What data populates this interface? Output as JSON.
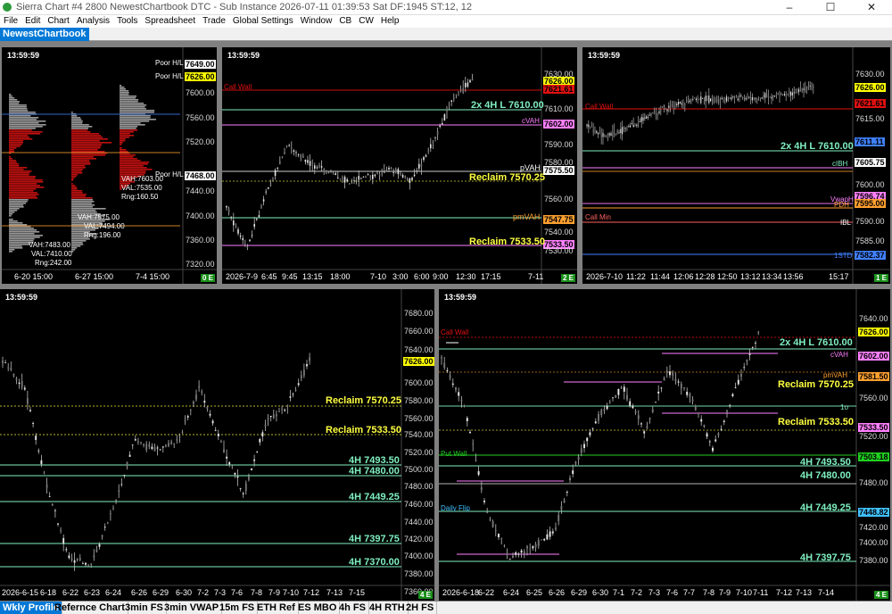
{
  "window": {
    "title": "Sierra Chart #4 2800 NewestChartbook DTC - Sub Instance 2026-07-11  01:39:53 Sat DF:1945  ST:12, 12",
    "minimize": "–",
    "maximize": "☐",
    "close": "✕"
  },
  "menu": [
    "File",
    "Edit",
    "Chart",
    "Analysis",
    "Tools",
    "Spreadsheet",
    "Trade",
    "Global Settings",
    "Window",
    "CB",
    "CW",
    "Help"
  ],
  "chartbook_name": "NewestChartbook",
  "colors": {
    "call_wall": "#e01010",
    "four_h_line": "#7ff0c0",
    "cvah": "#ff80ff",
    "pvah": "#ffffff",
    "reclaim": "#ffff40",
    "pmvah": "#ffa030",
    "put_wall": "#20d020",
    "daily_flip": "#40c0ff",
    "price_tag": "#ffff00"
  },
  "charts": [
    {
      "id": "c1",
      "time": "13:59:59",
      "corner": "0 E",
      "y_labels": [
        "7649.00",
        "7626.00",
        "7600.00",
        "7560.00",
        "7520.00",
        "7468.00",
        "7440.00",
        "7400.00",
        "7360.00",
        "7320.00"
      ],
      "x_labels": [
        "6-20  15:00",
        "6-27  15:00",
        "7-4  15:00"
      ],
      "annotations": [
        {
          "text": "Poor H/L",
          "color": "#ffffff"
        },
        {
          "text": "Poor H/L",
          "color": "#ffffff"
        },
        {
          "text": "Poor H/L",
          "color": "#ffffff"
        },
        {
          "text": "VAH:7603.00",
          "color": "#ffffff"
        },
        {
          "text": "VAL:7535.00",
          "color": "#ffffff"
        },
        {
          "text": "Rng:160.50",
          "color": "#ffffff"
        },
        {
          "text": "VAH:7575.00",
          "color": "#ffffff"
        },
        {
          "text": "VAL:7494.00",
          "color": "#ffffff"
        },
        {
          "text": "Rng:196.00",
          "color": "#ffffff"
        },
        {
          "text": "VAH:7483.00",
          "color": "#ffffff"
        },
        {
          "text": "VAL:7410.00",
          "color": "#ffffff"
        },
        {
          "text": "Rng:242.00",
          "color": "#ffffff"
        }
      ]
    },
    {
      "id": "c2",
      "time": "13:59:59",
      "corner": "2 E",
      "y_labels": [
        "7630.00",
        "7626.00",
        "7621.61",
        "7610.00",
        "7602.00",
        "7590.00",
        "7580.00",
        "7575.50",
        "7560.00",
        "7547.75",
        "7540.00",
        "7533.50",
        "7530.00"
      ],
      "x_labels": [
        "2026-7-9",
        "6:45",
        "9:45",
        "13:15",
        "18:00",
        "7-10",
        "3:00",
        "6:00",
        "9:00",
        "12:30",
        "17:15",
        "7-11"
      ],
      "annotations": [
        {
          "text": "Call Wall",
          "color": "#e01010"
        },
        {
          "text": "2x 4H L  7610.00",
          "color": "#7ff0c0"
        },
        {
          "text": "cVAH",
          "color": "#ff80ff"
        },
        {
          "text": "pVAH",
          "color": "#ffffff"
        },
        {
          "text": "Reclaim  7570.25",
          "color": "#ffff40"
        },
        {
          "text": "pmVAH",
          "color": "#ffa030"
        },
        {
          "text": "Reclaim  7533.50",
          "color": "#ffff40"
        }
      ]
    },
    {
      "id": "c3",
      "time": "13:59:59",
      "corner": "1 E",
      "y_labels": [
        "7630.00",
        "7626.00",
        "7621.61",
        "7615.00",
        "7611.11",
        "7605.75",
        "7600.00",
        "7596.74",
        "7595.00",
        "7590.00",
        "7585.00",
        "7582.37"
      ],
      "x_labels": [
        "2026-7-10",
        "11:22",
        "11:44",
        "12:06",
        "12:28",
        "12:50",
        "13:12",
        "13:34",
        "13:56",
        "15:17"
      ],
      "annotations": [
        {
          "text": "Call Wall",
          "color": "#e01010"
        },
        {
          "text": "2x 4H L  7610.00",
          "color": "#7ff0c0"
        },
        {
          "text": "cIBH",
          "color": "#7ff0c0"
        },
        {
          "text": "VwapH",
          "color": "#ff80ff"
        },
        {
          "text": "PDH",
          "color": "#ffa030"
        },
        {
          "text": "Call Min",
          "color": "#ff6060"
        },
        {
          "text": "IBL",
          "color": "#ffffff"
        },
        {
          "text": "1STD",
          "color": "#4080ff"
        }
      ]
    },
    {
      "id": "c4",
      "time": "13:59:59",
      "corner": "4 E",
      "y_labels": [
        "7680.00",
        "7660.00",
        "7640.00",
        "7626.00",
        "7600.00",
        "7580.00",
        "7560.00",
        "7540.00",
        "7520.00",
        "7500.00",
        "7480.00",
        "7460.00",
        "7440.00",
        "7420.00",
        "7400.00",
        "7380.00",
        "7360.00"
      ],
      "x_labels": [
        "2026-6-15",
        "6-18",
        "6-22",
        "6-23",
        "6-24",
        "6-26",
        "6-29",
        "6-30",
        "7-2",
        "7-3",
        "7-6",
        "7-8",
        "7-9",
        "7-10",
        "7-12",
        "7-13",
        "7-15"
      ],
      "annotations": [
        {
          "text": "Reclaim  7570.25",
          "color": "#ffff40"
        },
        {
          "text": "Reclaim  7533.50",
          "color": "#ffff40"
        },
        {
          "text": "4H  7493.50",
          "color": "#7ff0c0"
        },
        {
          "text": "4H  7480.00",
          "color": "#7ff0c0"
        },
        {
          "text": "4H  7449.25",
          "color": "#7ff0c0"
        },
        {
          "text": "4H  7397.75",
          "color": "#7ff0c0"
        },
        {
          "text": "4H  7370.00",
          "color": "#7ff0c0"
        }
      ]
    },
    {
      "id": "c5",
      "time": "13:59:59",
      "corner": "4 E",
      "y_labels": [
        "7640.00",
        "7626.00",
        "7602.00",
        "7581.50",
        "7560.00",
        "7533.50",
        "7520.00",
        "7503.18",
        "7480.00",
        "7448.82",
        "7420.00",
        "7400.00",
        "7380.00"
      ],
      "x_labels": [
        "2026-6-18",
        "6-22",
        "6-24",
        "6-25",
        "6-26",
        "6-29",
        "6-30",
        "7-1",
        "7-2",
        "7-3",
        "7-6",
        "7-7",
        "7-8",
        "7-9",
        "7-10",
        "7-11",
        "7-12",
        "7-13",
        "7-14"
      ],
      "annotations": [
        {
          "text": "Call Wall",
          "color": "#e01010"
        },
        {
          "text": "2x 4H L  7610.00",
          "color": "#7ff0c0"
        },
        {
          "text": "cVAH",
          "color": "#ff80ff"
        },
        {
          "text": "pmVAH",
          "color": "#ffa030"
        },
        {
          "text": "Reclaim  7570.25",
          "color": "#ffff40"
        },
        {
          "text": "1σ",
          "color": "#7ff0c0"
        },
        {
          "text": "Reclaim  7533.50",
          "color": "#ffff40"
        },
        {
          "text": "Put Wall",
          "color": "#20d020"
        },
        {
          "text": "4H  7493.50",
          "color": "#7ff0c0"
        },
        {
          "text": "4H  7480.00",
          "color": "#7ff0c0"
        },
        {
          "text": "Daily Flip",
          "color": "#40c0ff"
        },
        {
          "text": "4H  7449.25",
          "color": "#7ff0c0"
        },
        {
          "text": "4H  7397.75",
          "color": "#7ff0c0"
        }
      ]
    }
  ],
  "tabs": [
    "Wkly Profile",
    "Refernce Chart",
    "3min FS",
    "3min VWAP",
    "15m FS",
    "ETH Ref",
    "ES MBO",
    "4h FS",
    "4H RTH",
    "2H FS"
  ]
}
